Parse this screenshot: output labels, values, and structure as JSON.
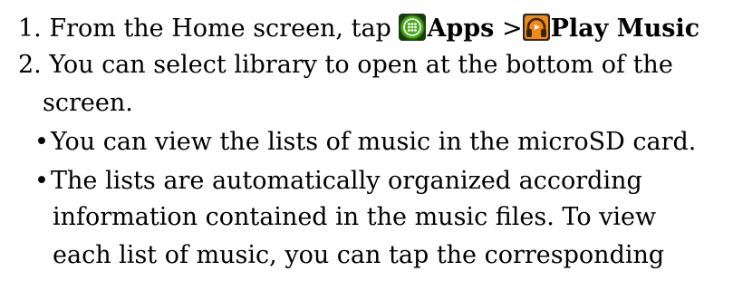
{
  "steps": {
    "step1": {
      "number": "1.",
      "text": "From the Home screen, tap",
      "apps_label": "Apps",
      "separator": ">",
      "play_music_label": "Play Music"
    },
    "step2": {
      "number": "2.",
      "line1": "You can select library to open at the bottom of the",
      "line2": "screen."
    }
  },
  "bullets": {
    "symbol": "•",
    "item1": "You can view the lists of music in the microSD card.",
    "item2": {
      "line1": "The lists are automatically organized according",
      "line2": "information contained in the music files. To view",
      "line3": "each list of music, you can tap the corresponding"
    }
  },
  "icons": {
    "apps": "apps-grid-icon",
    "play_music": "headphones-icon"
  },
  "colors": {
    "apps_icon_green": "#4caa1e",
    "play_music_orange": "#f08a14",
    "text": "#000000"
  }
}
